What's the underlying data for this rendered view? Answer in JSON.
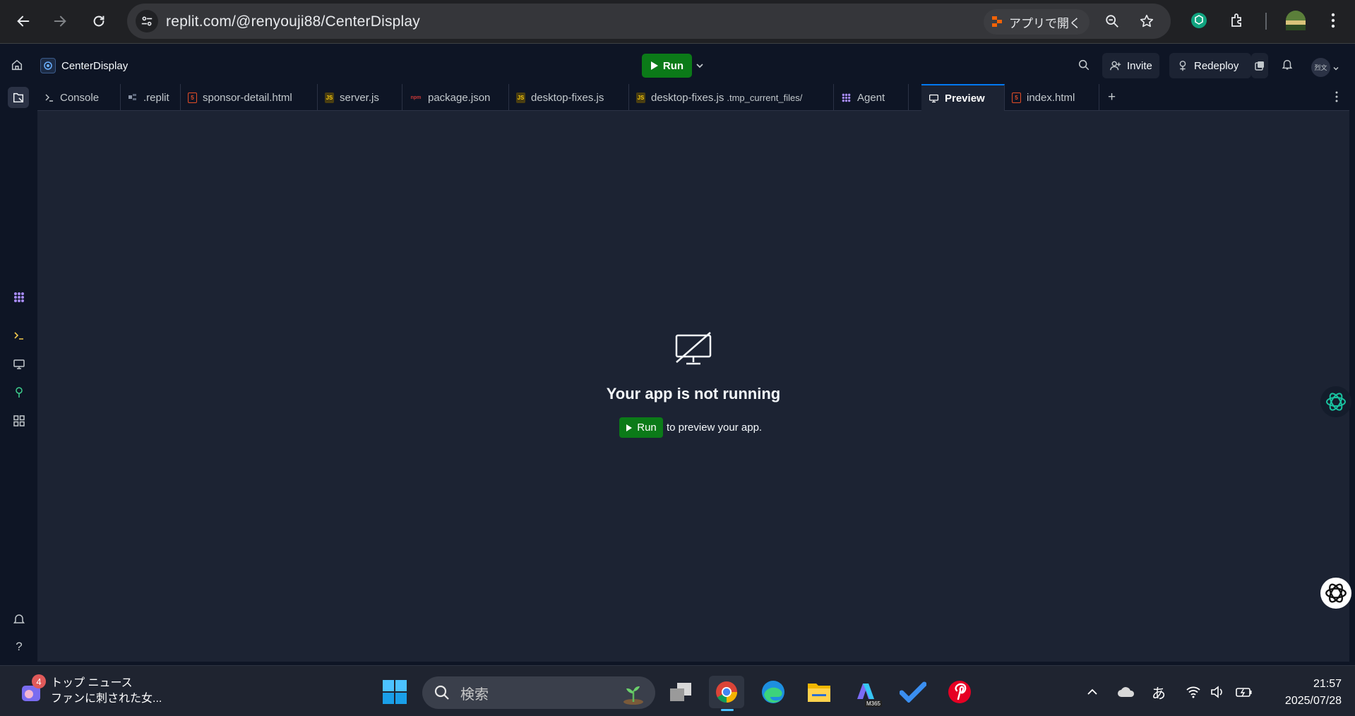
{
  "browser": {
    "url": "replit.com/@renyouji88/CenterDisplay",
    "open_in_app_label": "アプリで開く"
  },
  "header": {
    "project_name": "CenterDisplay",
    "run_label": "Run",
    "invite_label": "Invite",
    "redeploy_label": "Redeploy",
    "avatar_text": "烈文"
  },
  "tabs": [
    {
      "label": "Console",
      "icon": "console-icon"
    },
    {
      "label": ".replit",
      "icon": "config-file-icon"
    },
    {
      "label": "sponsor-detail.html",
      "icon": "html-file-icon"
    },
    {
      "label": "server.js",
      "icon": "js-file-icon"
    },
    {
      "label": "package.json",
      "icon": "npm-file-icon"
    },
    {
      "label": "desktop-fixes.js",
      "icon": "js-file-icon"
    },
    {
      "label": "desktop-fixes.js",
      "path_suffix": ".tmp_current_files/",
      "icon": "js-file-icon"
    },
    {
      "label": "Agent",
      "icon": "agent-icon"
    },
    {
      "label": "Preview",
      "icon": "monitor-icon",
      "active": true
    },
    {
      "label": "index.html",
      "icon": "html-file-icon"
    }
  ],
  "preview": {
    "title": "Your app is not running",
    "run_label": "Run",
    "suffix_text": "to preview your app."
  },
  "taskbar": {
    "news_badge": "4",
    "news_title": "トップ ニュース",
    "news_headline": "ファンに刺された女...",
    "search_placeholder": "検索",
    "ime_label": "あ",
    "time": "21:57",
    "date": "2025/07/28",
    "m365_label": "M365"
  },
  "colors": {
    "run_green": "#0b7a18",
    "bg_dark": "#0e1525",
    "panel": "#1c2333",
    "accent_blue": "#0079f2"
  }
}
